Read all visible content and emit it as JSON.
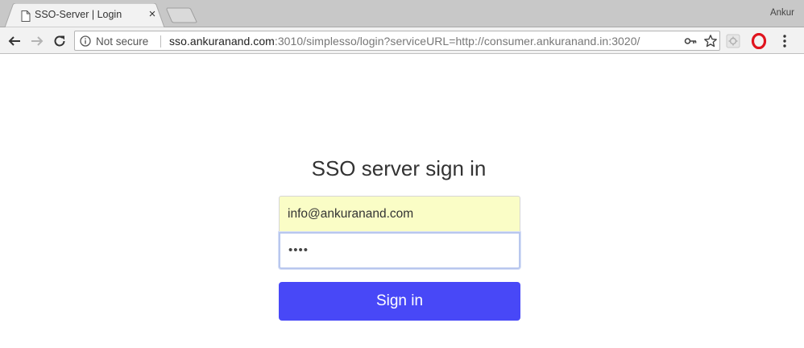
{
  "browser": {
    "tab": {
      "title": "SSO-Server | Login",
      "close": "×"
    },
    "profile_name": "Ankur",
    "omnibox": {
      "security_label": "Not secure",
      "url_host": "sso.ankuranand.com",
      "url_rest": ":3010/simplesso/login?serviceURL=http://consumer.ankuranand.in:3020/"
    }
  },
  "page": {
    "heading": "SSO server sign in",
    "email_value": "info@ankuranand.com",
    "password_mask": "••••",
    "submit_label": "Sign in"
  },
  "colors": {
    "button": "#4848f7",
    "autofill": "#fafdc6",
    "focus_border": "#b8c7ee"
  }
}
